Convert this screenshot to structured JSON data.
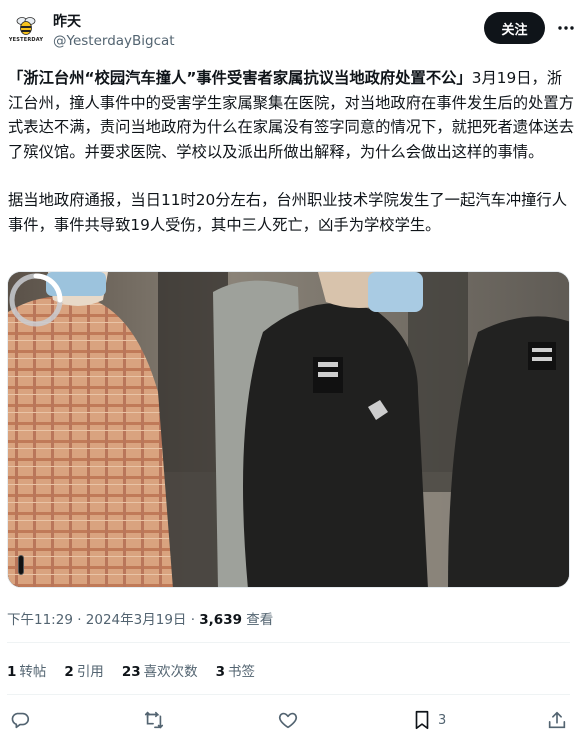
{
  "header": {
    "display_name": "昨天",
    "handle": "@YesterdayBigcat",
    "avatar_label": "YESTERDAY",
    "follow_label": "关注",
    "more_icon": "ellipsis-icon"
  },
  "post": {
    "headline": "「浙江台州“校园汽车撞人”事件受害者家属抗议当地政府处置不公」",
    "paragraph1": "3月19日，浙江台州，撞人事件中的受害学生家属聚集在医院，对当地政府在事件发生后的处置方式表达不满，责问当地政府为什么在家属没有签字同意的情况下，就把死者遗体送去了殡仪馆。并要求医院、学校以及派出所做出解释，为什么会做出这样的事情。",
    "paragraph2": "据当地政府通报，当日11时20分左右，台州职业技术学院发生了一起汽车冲撞行人事件，事件共导致19人受伤，其中三人死亡，凶手为学校学生。"
  },
  "media": {
    "type": "video",
    "state": "loading"
  },
  "meta": {
    "time": "下午11:29",
    "separator": " · ",
    "date": "2024年3月19日",
    "views_count": "3,639",
    "views_label": " 查看"
  },
  "stats": [
    {
      "count": "1",
      "label": "转帖"
    },
    {
      "count": "2",
      "label": "引用"
    },
    {
      "count": "23",
      "label": "喜欢次数"
    },
    {
      "count": "3",
      "label": "书签"
    }
  ],
  "actions": {
    "reply_icon": "reply-icon",
    "repost_icon": "repost-icon",
    "like_icon": "like-icon",
    "bookmark_icon": "bookmark-icon",
    "bookmark_count": "3",
    "share_icon": "share-icon"
  },
  "colors": {
    "text": "#0f1419",
    "secondary": "#536471",
    "follow_bg": "#0f1419",
    "divider": "#eff3f4"
  }
}
